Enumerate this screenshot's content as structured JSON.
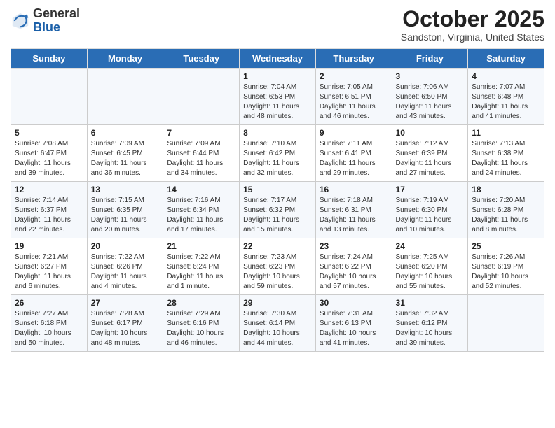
{
  "header": {
    "logo_general": "General",
    "logo_blue": "Blue",
    "month_title": "October 2025",
    "location": "Sandston, Virginia, United States"
  },
  "days_of_week": [
    "Sunday",
    "Monday",
    "Tuesday",
    "Wednesday",
    "Thursday",
    "Friday",
    "Saturday"
  ],
  "weeks": [
    [
      {
        "day": "",
        "info": ""
      },
      {
        "day": "",
        "info": ""
      },
      {
        "day": "",
        "info": ""
      },
      {
        "day": "1",
        "info": "Sunrise: 7:04 AM\nSunset: 6:53 PM\nDaylight: 11 hours\nand 48 minutes."
      },
      {
        "day": "2",
        "info": "Sunrise: 7:05 AM\nSunset: 6:51 PM\nDaylight: 11 hours\nand 46 minutes."
      },
      {
        "day": "3",
        "info": "Sunrise: 7:06 AM\nSunset: 6:50 PM\nDaylight: 11 hours\nand 43 minutes."
      },
      {
        "day": "4",
        "info": "Sunrise: 7:07 AM\nSunset: 6:48 PM\nDaylight: 11 hours\nand 41 minutes."
      }
    ],
    [
      {
        "day": "5",
        "info": "Sunrise: 7:08 AM\nSunset: 6:47 PM\nDaylight: 11 hours\nand 39 minutes."
      },
      {
        "day": "6",
        "info": "Sunrise: 7:09 AM\nSunset: 6:45 PM\nDaylight: 11 hours\nand 36 minutes."
      },
      {
        "day": "7",
        "info": "Sunrise: 7:09 AM\nSunset: 6:44 PM\nDaylight: 11 hours\nand 34 minutes."
      },
      {
        "day": "8",
        "info": "Sunrise: 7:10 AM\nSunset: 6:42 PM\nDaylight: 11 hours\nand 32 minutes."
      },
      {
        "day": "9",
        "info": "Sunrise: 7:11 AM\nSunset: 6:41 PM\nDaylight: 11 hours\nand 29 minutes."
      },
      {
        "day": "10",
        "info": "Sunrise: 7:12 AM\nSunset: 6:39 PM\nDaylight: 11 hours\nand 27 minutes."
      },
      {
        "day": "11",
        "info": "Sunrise: 7:13 AM\nSunset: 6:38 PM\nDaylight: 11 hours\nand 24 minutes."
      }
    ],
    [
      {
        "day": "12",
        "info": "Sunrise: 7:14 AM\nSunset: 6:37 PM\nDaylight: 11 hours\nand 22 minutes."
      },
      {
        "day": "13",
        "info": "Sunrise: 7:15 AM\nSunset: 6:35 PM\nDaylight: 11 hours\nand 20 minutes."
      },
      {
        "day": "14",
        "info": "Sunrise: 7:16 AM\nSunset: 6:34 PM\nDaylight: 11 hours\nand 17 minutes."
      },
      {
        "day": "15",
        "info": "Sunrise: 7:17 AM\nSunset: 6:32 PM\nDaylight: 11 hours\nand 15 minutes."
      },
      {
        "day": "16",
        "info": "Sunrise: 7:18 AM\nSunset: 6:31 PM\nDaylight: 11 hours\nand 13 minutes."
      },
      {
        "day": "17",
        "info": "Sunrise: 7:19 AM\nSunset: 6:30 PM\nDaylight: 11 hours\nand 10 minutes."
      },
      {
        "day": "18",
        "info": "Sunrise: 7:20 AM\nSunset: 6:28 PM\nDaylight: 11 hours\nand 8 minutes."
      }
    ],
    [
      {
        "day": "19",
        "info": "Sunrise: 7:21 AM\nSunset: 6:27 PM\nDaylight: 11 hours\nand 6 minutes."
      },
      {
        "day": "20",
        "info": "Sunrise: 7:22 AM\nSunset: 6:26 PM\nDaylight: 11 hours\nand 4 minutes."
      },
      {
        "day": "21",
        "info": "Sunrise: 7:22 AM\nSunset: 6:24 PM\nDaylight: 11 hours\nand 1 minute."
      },
      {
        "day": "22",
        "info": "Sunrise: 7:23 AM\nSunset: 6:23 PM\nDaylight: 10 hours\nand 59 minutes."
      },
      {
        "day": "23",
        "info": "Sunrise: 7:24 AM\nSunset: 6:22 PM\nDaylight: 10 hours\nand 57 minutes."
      },
      {
        "day": "24",
        "info": "Sunrise: 7:25 AM\nSunset: 6:20 PM\nDaylight: 10 hours\nand 55 minutes."
      },
      {
        "day": "25",
        "info": "Sunrise: 7:26 AM\nSunset: 6:19 PM\nDaylight: 10 hours\nand 52 minutes."
      }
    ],
    [
      {
        "day": "26",
        "info": "Sunrise: 7:27 AM\nSunset: 6:18 PM\nDaylight: 10 hours\nand 50 minutes."
      },
      {
        "day": "27",
        "info": "Sunrise: 7:28 AM\nSunset: 6:17 PM\nDaylight: 10 hours\nand 48 minutes."
      },
      {
        "day": "28",
        "info": "Sunrise: 7:29 AM\nSunset: 6:16 PM\nDaylight: 10 hours\nand 46 minutes."
      },
      {
        "day": "29",
        "info": "Sunrise: 7:30 AM\nSunset: 6:14 PM\nDaylight: 10 hours\nand 44 minutes."
      },
      {
        "day": "30",
        "info": "Sunrise: 7:31 AM\nSunset: 6:13 PM\nDaylight: 10 hours\nand 41 minutes."
      },
      {
        "day": "31",
        "info": "Sunrise: 7:32 AM\nSunset: 6:12 PM\nDaylight: 10 hours\nand 39 minutes."
      },
      {
        "day": "",
        "info": ""
      }
    ]
  ]
}
